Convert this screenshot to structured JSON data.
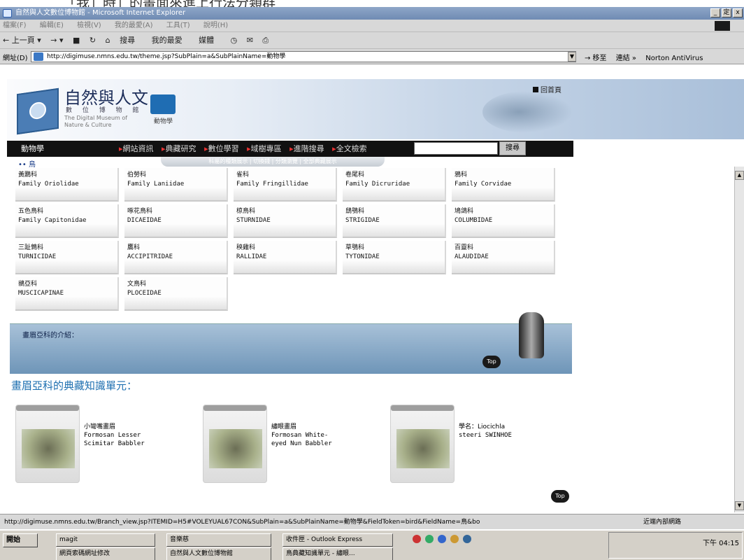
{
  "top_caption": "「我」時」的畫面來進上行法分類群",
  "window": {
    "title": "自然與人文數位博物館 - Microsoft Internet Explorer",
    "controls": [
      "_",
      "定",
      "x"
    ]
  },
  "menus": [
    "檔案(F)",
    "編輯(E)",
    "檢視(V)",
    "我的最愛(A)",
    "工具(T)",
    "說明(H)"
  ],
  "toolbar": {
    "back_label": "← 上一頁 ▾",
    "forward_label": "→ ▾",
    "search_label": "搜尋",
    "favorites_label": "我的最愛",
    "media_label": "媒體"
  },
  "address": {
    "label": "網址(D)",
    "url": "http://digimuse.nmns.edu.tw/theme.jsp?SubPlain=a&SubPlainName=動物學",
    "go_label": "→ 移至",
    "links_label": "連結 »",
    "norton_label": "Norton AntiVirus"
  },
  "site": {
    "title": "自然與人文",
    "subtitle": "數 位 博 物 館",
    "english": "The Digital Museum of Nature & Culture",
    "section_icon_label": "動物學",
    "home_link": "回首頁"
  },
  "nav": {
    "category": "動物學",
    "items": [
      "網站資訊",
      "典藏研究",
      "數位學習",
      "域樹專區",
      "進階搜尋",
      "全文檢索"
    ],
    "search_button": "搜尋"
  },
  "subnav": "科屬的種類展示 | 切換錢 | 分類瀏覽 | 全部典藏展示",
  "breadcrumb": "•• 鳥",
  "families": [
    {
      "zh": "黃鸝科",
      "en": "Family Oriolidae"
    },
    {
      "zh": "伯勞科",
      "en": "Family Laniidae"
    },
    {
      "zh": "雀科",
      "en": "Family Fringillidae"
    },
    {
      "zh": "卷尾科",
      "en": "Family Dicruridae"
    },
    {
      "zh": "鴉科",
      "en": "Family Corvidae"
    },
    {
      "zh": "五色鳥科",
      "en": "Family Capitonidae"
    },
    {
      "zh": "啄花鳥科",
      "en": "DICAEIDAE"
    },
    {
      "zh": "椋鳥科",
      "en": "STURNIDAE"
    },
    {
      "zh": "鴟鴞科",
      "en": "STRIGIDAE"
    },
    {
      "zh": "鳩鴿科",
      "en": "COLUMBIDAE"
    },
    {
      "zh": "三趾鶉科",
      "en": "TURNICIDAE"
    },
    {
      "zh": "鷹科",
      "en": "ACCIPITRIDAE"
    },
    {
      "zh": "秧雞科",
      "en": "RALLIDAE"
    },
    {
      "zh": "草鴞科",
      "en": "TYTONIDAE"
    },
    {
      "zh": "百靈科",
      "en": "ALAUDIDAE"
    },
    {
      "zh": "鶲亞科",
      "en": "MUSCICAPINAE"
    },
    {
      "zh": "文鳥科",
      "en": "PLOCEIDAE"
    }
  ],
  "intro": {
    "label": "畫眉亞科的介紹：",
    "top_label": "Top"
  },
  "units": {
    "title": "畫眉亞科的典藏知識單元：",
    "items": [
      {
        "zh": "小彎嘴畫眉",
        "en1": "Formosan Lesser",
        "en2": "Scimitar Babbler"
      },
      {
        "zh": "繡眼畫眉",
        "en1": "Formosan White-",
        "en2": "eyed Nun Babbler"
      },
      {
        "zh": "學名：Liocichla",
        "en1": "steeri SWINHOE",
        "en2": ""
      }
    ],
    "top_label": "Top"
  },
  "status": {
    "url": "http://digimuse.nmns.edu.tw/Branch_view.jsp?ITEMID=H5#VOLEYUAL67CON&SubPlain=a&SubPlainName=動物學&FieldToken=bird&FieldName=鳥&bo",
    "zone": "近端內部網路"
  },
  "taskbar": {
    "start": "開始",
    "tasks": [
      "magit",
      "音樂慈",
      "收件匣 - Outlook Express",
      "網頁索碼網址修改",
      "自然與人文數位博物館",
      "鳥典藏知識單元 - 繡眼..."
    ],
    "clock": "下午 04:15"
  }
}
